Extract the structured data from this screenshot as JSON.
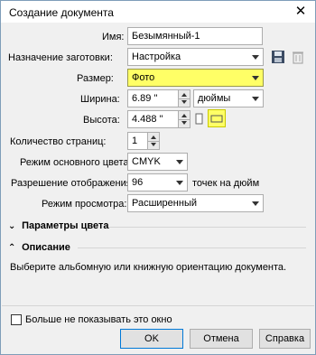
{
  "window": {
    "title": "Создание документа",
    "close_glyph": "✕"
  },
  "form": {
    "name_label": "Имя:",
    "name_value": "Безымянный-1",
    "preset_label": "Назначение заготовки:",
    "preset_value": "Настройка",
    "size_label": "Размер:",
    "size_value": "Фото",
    "width_label": "Ширина:",
    "width_value": "6.89 \"",
    "units_value": "дюймы",
    "height_label": "Высота:",
    "height_value": "4.488 \"",
    "pages_label": "Количество страниц:",
    "pages_value": "1",
    "color_mode_label": "Режим основного цвета:",
    "color_mode_value": "CMYK",
    "resolution_label": "Разрешение отображения:",
    "resolution_value": "96",
    "resolution_unit": "точек на дюйм",
    "preview_label": "Режим просмотра:",
    "preview_value": "Расширенный"
  },
  "sections": {
    "color_params": "Параметры цвета",
    "description": "Описание",
    "description_text": "Выберите альбомную или книжную ориентацию документа."
  },
  "footer": {
    "dont_show": "Больше не показывать это окно",
    "ok": "OK",
    "cancel": "Отмена",
    "help": "Справка"
  },
  "colors": {
    "highlight_yellow": "#ffff66",
    "default_button_border": "#0078d7"
  },
  "icons": {
    "save_preset": "save-icon",
    "delete_preset": "trash-icon",
    "portrait": "portrait-orientation-icon",
    "landscape": "landscape-orientation-icon",
    "collapsed": "chevron-double-down-icon",
    "expanded": "chevron-double-up-icon"
  }
}
